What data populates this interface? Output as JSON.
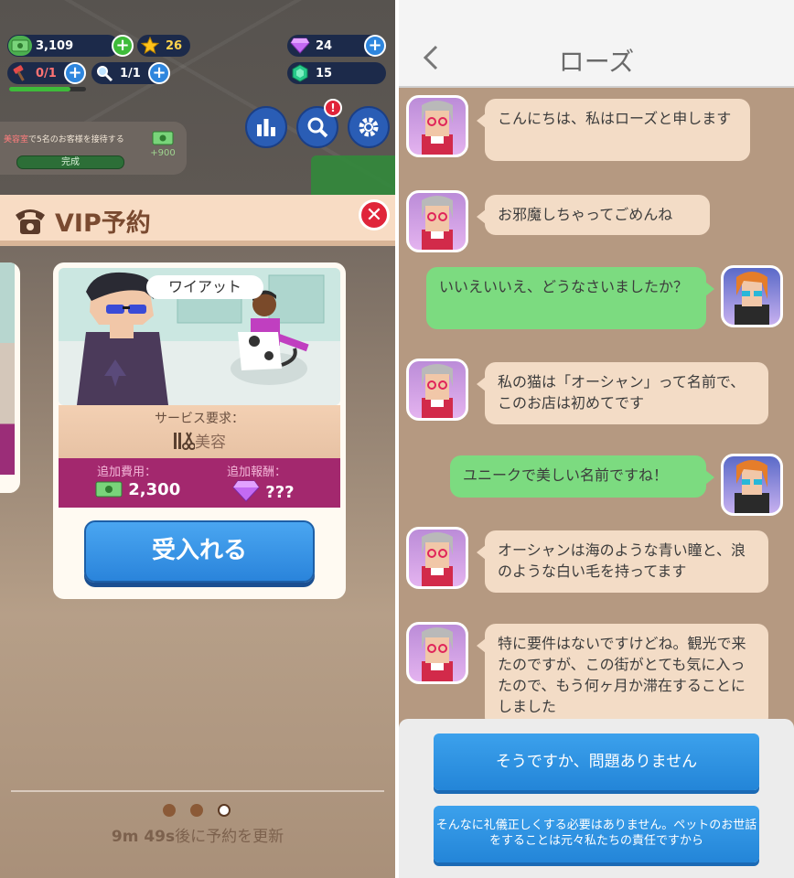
{
  "hud": {
    "cash": "3,109",
    "stars": "26",
    "gems": "24",
    "emeralds": "15",
    "hammer": "0/1",
    "magnifier": "1/1"
  },
  "task": {
    "text_highlight": "美容室",
    "text_rest": "で5名のお客様を接待する",
    "status": "完成",
    "reward": "+900"
  },
  "vip": {
    "title": "VIP予約",
    "customer_name": "ワイアット",
    "service_label": "サービス要求：",
    "service_value": "美容",
    "extra_cost_label": "追加費用：",
    "extra_cost_value": "2,300",
    "extra_reward_label": "追加報酬：",
    "extra_reward_value": "???",
    "accept_button": "受入れる"
  },
  "footer": {
    "timer": "9m 49s",
    "timer_suffix": "後に予約を更新"
  },
  "chat": {
    "contact_name": "ローズ",
    "messages": [
      {
        "from": "rose",
        "text": "こんにちは、私はローズと申します"
      },
      {
        "from": "rose",
        "text": "お邪魔しちゃってごめんね"
      },
      {
        "from": "me",
        "text": "いいえいいえ、どうなさいましたか？"
      },
      {
        "from": "rose",
        "text": "私の猫は「オーシャン」って名前で、このお店は初めてです"
      },
      {
        "from": "me",
        "text": "ユニークで美しい名前ですね！"
      },
      {
        "from": "rose",
        "text": "オーシャンは海のような青い瞳と、浪のような白い毛を持ってます"
      },
      {
        "from": "rose",
        "text": "特に要件はないですけどね。観光で来たのですが、この街がとても気に入ったので、もう何ヶ月か滞在することにしました"
      }
    ],
    "replies": [
      "そうですか、問題ありません",
      "そんなに礼儀正しくする必要はありません。ペットのお世話をすることは元々私たちの責任ですから"
    ]
  },
  "icons": {
    "cash": "cash-icon",
    "star": "star-icon",
    "gem": "purple-gem-icon",
    "emerald": "green-gem-icon",
    "hammer": "hammer-icon",
    "magnifier": "magnifier-icon",
    "stats": "bar-chart-icon",
    "search": "search-icon",
    "settings": "gear-icon",
    "phone": "phone-icon",
    "close": "close-icon",
    "back": "chevron-left-icon"
  },
  "colors": {
    "accent_blue": "#2a84db",
    "close_red": "#e0243a",
    "bubble_rose": "#f3dcc6",
    "bubble_me": "#7cdb80",
    "vip_purple": "#a3286e"
  }
}
